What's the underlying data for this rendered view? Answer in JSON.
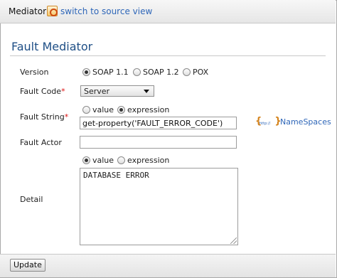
{
  "header": {
    "title": "Mediator",
    "source_link": "switch to source view",
    "source_icon": "source-view-icon"
  },
  "form": {
    "heading": "Fault Mediator",
    "version": {
      "label": "Version",
      "options": [
        "SOAP 1.1",
        "SOAP 1.2",
        "POX"
      ],
      "selected": "SOAP 1.1"
    },
    "fault_code": {
      "label": "Fault Code",
      "required_mark": "*",
      "selected": "Server"
    },
    "fault_string": {
      "label": "Fault String",
      "required_mark": "*",
      "options": [
        "value",
        "expression"
      ],
      "selected": "expression",
      "input_value": "get-property('FAULT_ERROR_CODE')"
    },
    "namespaces": {
      "icon": "namespace-icon",
      "icon_text": "http://",
      "label": "NameSpaces"
    },
    "fault_actor": {
      "label": "Fault Actor",
      "input_value": ""
    },
    "detail": {
      "label": "Detail",
      "options": [
        "value",
        "expression"
      ],
      "selected": "value",
      "text": "DATABASE ERROR"
    }
  },
  "footer": {
    "update_label": "Update"
  },
  "colors": {
    "link": "#2e66b8",
    "heading": "#1f4f86",
    "required": "#dd1111"
  }
}
